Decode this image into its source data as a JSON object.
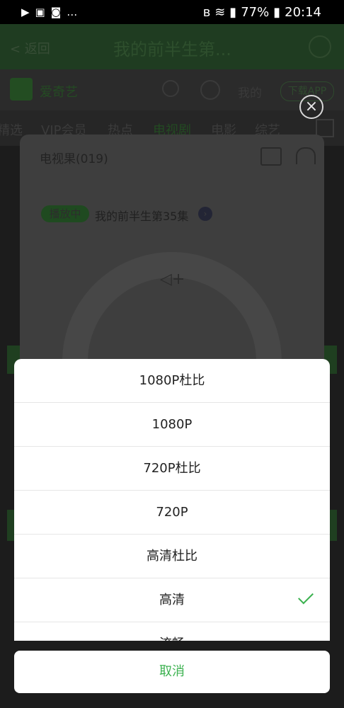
{
  "status": {
    "time": "20:14",
    "battery": "77%"
  },
  "header": {
    "back": "< 返回",
    "title": "我的前半生第..."
  },
  "logobar": {
    "name": "爱奇艺",
    "mine": "我的",
    "download": "下载APP"
  },
  "tabs": [
    "精选",
    "VIP会员",
    "热点",
    "电视剧",
    "电影",
    "综艺"
  ],
  "remote": {
    "device": "电视果(019)",
    "badge": "播放中",
    "now_playing": "我的前半生第35集"
  },
  "options": [
    "1080P杜比",
    "1080P",
    "720P杜比",
    "720P",
    "高清杜比",
    "高清",
    "流畅"
  ],
  "selected_option": "高清",
  "cancel": "取消",
  "colors": {
    "accent": "#3cb250"
  }
}
